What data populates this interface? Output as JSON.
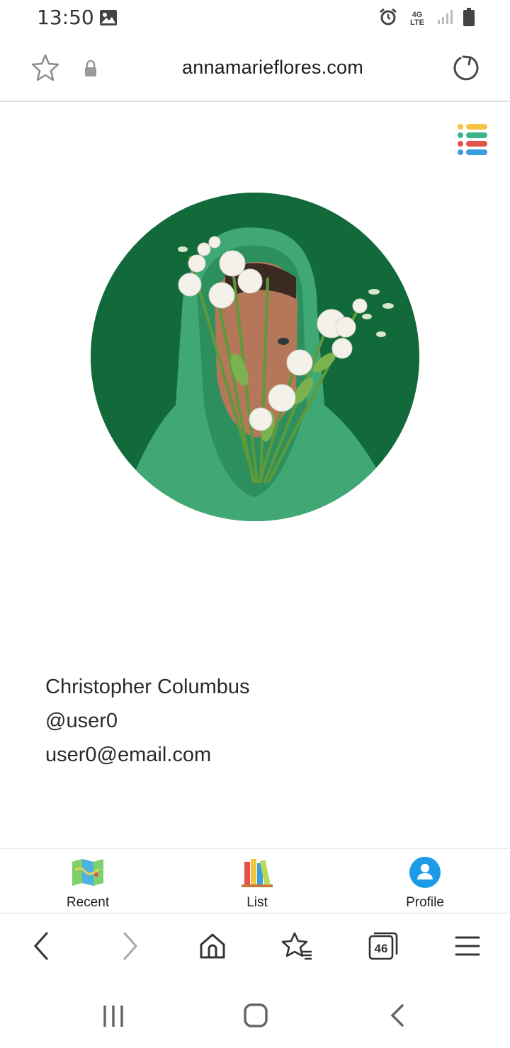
{
  "status_bar": {
    "time": "13:50",
    "network": "4G LTE",
    "icons": [
      "gallery-icon",
      "alarm-icon",
      "signal-icon",
      "battery-icon"
    ]
  },
  "browser": {
    "url": "annamarieflores.com",
    "tab_count": "46"
  },
  "profile": {
    "name": "Christopher Columbus",
    "username": "@user0",
    "email": "user0@email.com"
  },
  "app_nav": {
    "items": [
      {
        "label": "Recent",
        "icon": "map-icon"
      },
      {
        "label": "List",
        "icon": "books-icon"
      },
      {
        "label": "Profile",
        "icon": "profile-icon"
      }
    ]
  },
  "colors": {
    "avatar_bg": "#12693a",
    "profile_blue": "#1e9be8",
    "menu_yellow": "#f5c342",
    "menu_green": "#3ab58a",
    "menu_red": "#e0524a",
    "menu_blue": "#3a9ee0"
  }
}
